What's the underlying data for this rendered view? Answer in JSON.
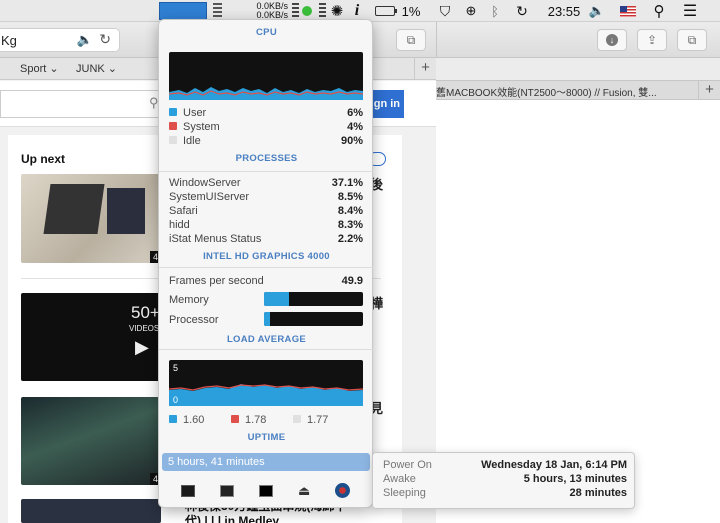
{
  "menubar": {
    "net_up": "0.0KB/s",
    "net_down": "0.0KB/s",
    "battery": "1%",
    "time": "23:55",
    "istat_label": "i"
  },
  "safari_left": {
    "address_text": "Kg",
    "bookmarks": [
      "Sport",
      "JUNK"
    ],
    "sign_in": "gn in",
    "up_next": "Up next",
    "thumb_badge_1": "4",
    "thumb_badge_3": "4",
    "thumb2_text": "50+",
    "thumb2_sub": "VIDEOS",
    "side_char_1": "後",
    "side_char_2": "樺",
    "side_char_3": "見",
    "bottom_text_1": "林俊傑30万鐘玉曲串燒(海綿午",
    "bottom_text_2": "代) | | | in Medley"
  },
  "safari_right": {
    "tab_title": "舊MACBOOK效能(NT2500～8000) // Fusion, 雙..."
  },
  "popover": {
    "cpu_section": "CPU",
    "cpu_rows": [
      {
        "label": "User",
        "value": "6%",
        "color": "#2a9fdc"
      },
      {
        "label": "System",
        "value": "4%",
        "color": "#e0504a"
      },
      {
        "label": "Idle",
        "value": "90%",
        "color": "#e0e0e0"
      }
    ],
    "processes_section": "PROCESSES",
    "processes": [
      {
        "name": "WindowServer",
        "value": "37.1%"
      },
      {
        "name": "SystemUIServer",
        "value": "8.5%"
      },
      {
        "name": "Safari",
        "value": "8.4%"
      },
      {
        "name": "hidd",
        "value": "8.3%"
      },
      {
        "name": "iStat Menus Status",
        "value": "2.2%"
      }
    ],
    "gpu_section": "INTEL HD GRAPHICS 4000",
    "fps_label": "Frames per second",
    "fps_value": "49.9",
    "memory_label": "Memory",
    "memory_level": 0.25,
    "processor_label": "Processor",
    "processor_level": 0.06,
    "load_section": "LOAD AVERAGE",
    "load_scale_max": "5",
    "load_scale_min": "0",
    "load_values": [
      {
        "value": "1.60",
        "color": "#2a9fdc"
      },
      {
        "value": "1.78",
        "color": "#e0504a"
      },
      {
        "value": "1.77",
        "color": "#e0e0e0"
      }
    ],
    "uptime_section": "UPTIME",
    "uptime_value": "5 hours, 41 minutes"
  },
  "tooltip": {
    "rows": [
      {
        "label": "Power On",
        "value": "Wednesday 18 Jan, 6:14 PM"
      },
      {
        "label": "Awake",
        "value": "5 hours, 13 minutes"
      },
      {
        "label": "Sleeping",
        "value": "28 minutes"
      }
    ]
  }
}
